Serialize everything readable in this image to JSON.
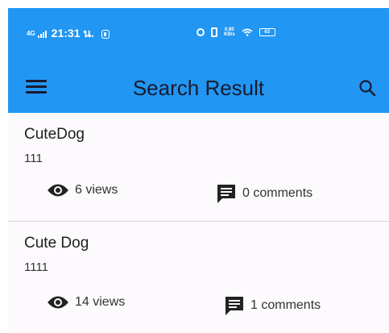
{
  "status_bar": {
    "network": "4G",
    "time": "21:31 น.",
    "speed_value": "0.80",
    "speed_unit": "KB/s",
    "battery": "63"
  },
  "app_bar": {
    "title": "Search Result",
    "menu_icon": "menu-icon",
    "search_icon": "search-icon"
  },
  "results": [
    {
      "title": "CuteDog",
      "body": "111",
      "views": "6 views",
      "comments": "0 comments"
    },
    {
      "title": "Cute Dog",
      "body": "1111",
      "views": "14 views",
      "comments": "1 comments"
    }
  ],
  "colors": {
    "app_bar": "#2196f3",
    "text": "#202020",
    "divider": "#d8d4da"
  }
}
